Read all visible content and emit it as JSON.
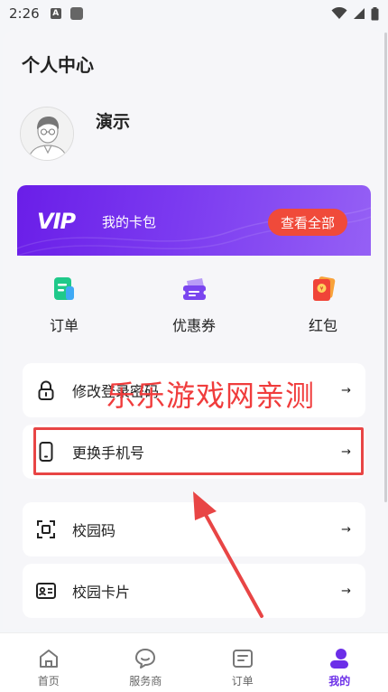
{
  "status_bar": {
    "time": "2:26",
    "badge": "A"
  },
  "header": {
    "title": "个人中心"
  },
  "user": {
    "name": "演示"
  },
  "vip": {
    "logo": "VIP",
    "title": "我的卡包",
    "view_all": "查看全部"
  },
  "quick_actions": [
    {
      "label": "订单",
      "icon": "order-icon"
    },
    {
      "label": "优惠券",
      "icon": "coupon-icon"
    },
    {
      "label": "红包",
      "icon": "red-packet-icon"
    }
  ],
  "menu": [
    {
      "label": "修改登录密码",
      "icon": "lock-icon"
    },
    {
      "label": "更换手机号",
      "icon": "phone-icon"
    },
    {
      "label": "校园码",
      "icon": "scan-icon"
    },
    {
      "label": "校园卡片",
      "icon": "id-card-icon"
    }
  ],
  "menu_arrow": "→",
  "watermark": "乐乐游戏网亲测",
  "tabs": [
    {
      "label": "首页",
      "icon": "home-icon",
      "active": false
    },
    {
      "label": "服务商",
      "icon": "chat-icon",
      "active": false
    },
    {
      "label": "订单",
      "icon": "order-tab-icon",
      "active": false
    },
    {
      "label": "我的",
      "icon": "profile-icon",
      "active": true
    }
  ],
  "colors": {
    "accent": "#6b2ee8",
    "vip_button": "#f04a3a",
    "annotation": "#e84545"
  }
}
